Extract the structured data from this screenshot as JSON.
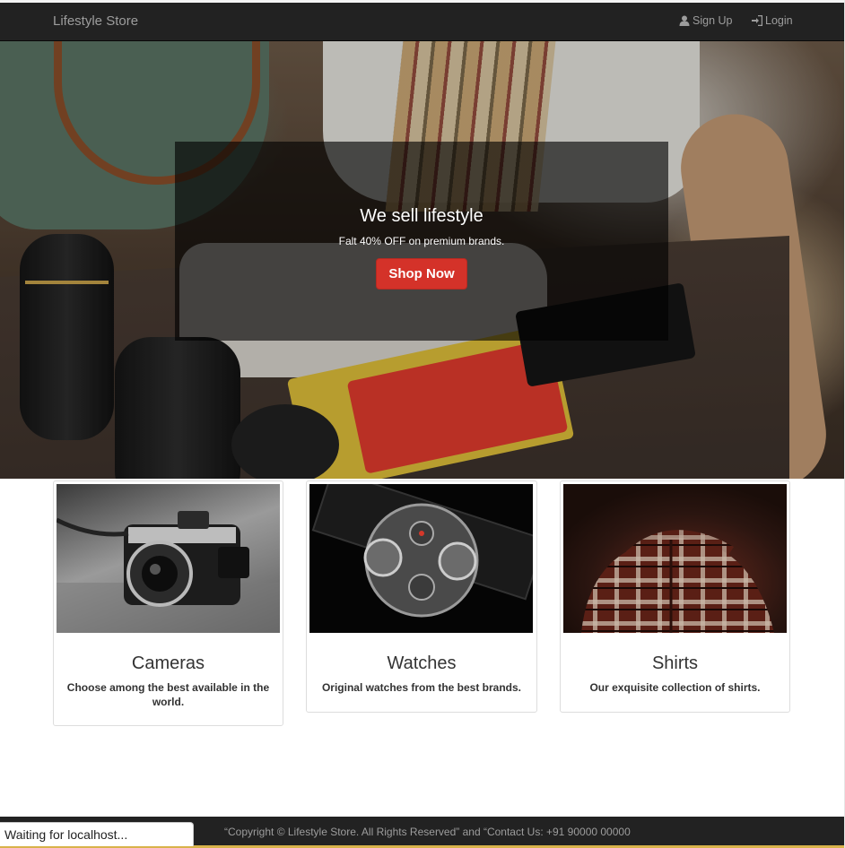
{
  "navbar": {
    "brand": "Lifestyle Store",
    "links": [
      {
        "label": "Sign Up",
        "icon": "user-icon"
      },
      {
        "label": "Login",
        "icon": "login-icon"
      }
    ]
  },
  "hero": {
    "title": "We sell lifestyle",
    "subtitle": "Falt 40% OFF on premium brands.",
    "button_label": "Shop Now",
    "button_color": "#d43229"
  },
  "products": [
    {
      "title": "Cameras",
      "description": "Choose among the best available in the world."
    },
    {
      "title": "Watches",
      "description": "Original watches from the best brands."
    },
    {
      "title": "Shirts",
      "description": "Our exquisite collection of shirts."
    }
  ],
  "footer": {
    "text": "“Copyright © Lifestyle Store. All Rights Reserved” and “Contact Us: +91 90000 00000"
  },
  "browser_status": {
    "text": "Waiting for localhost..."
  }
}
